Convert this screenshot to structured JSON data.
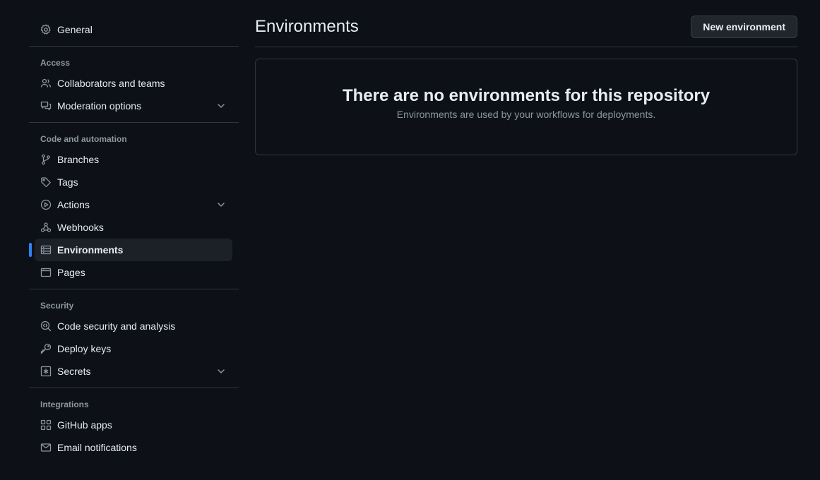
{
  "sidebar": {
    "general": {
      "label": "General",
      "icon": "gear-icon"
    },
    "sections": {
      "access": {
        "heading": "Access",
        "items": [
          {
            "label": "Collaborators and teams",
            "icon": "people-icon"
          },
          {
            "label": "Moderation options",
            "icon": "comment-discussion-icon"
          }
        ]
      },
      "code": {
        "heading": "Code and automation",
        "items": [
          {
            "label": "Branches",
            "icon": "git-branch-icon"
          },
          {
            "label": "Tags",
            "icon": "tag-icon"
          },
          {
            "label": "Actions",
            "icon": "play-icon"
          },
          {
            "label": "Webhooks",
            "icon": "webhook-icon"
          },
          {
            "label": "Environments",
            "icon": "server-icon"
          },
          {
            "label": "Pages",
            "icon": "browser-icon"
          }
        ]
      },
      "security": {
        "heading": "Security",
        "items": [
          {
            "label": "Code security and analysis",
            "icon": "codescan-icon"
          },
          {
            "label": "Deploy keys",
            "icon": "key-icon"
          },
          {
            "label": "Secrets",
            "icon": "key-asterisk-icon"
          }
        ]
      },
      "integrations": {
        "heading": "Integrations",
        "items": [
          {
            "label": "GitHub apps",
            "icon": "apps-icon"
          },
          {
            "label": "Email notifications",
            "icon": "mail-icon"
          }
        ]
      }
    },
    "active_item": "Environments"
  },
  "main": {
    "title": "Environments",
    "new_button_label": "New environment",
    "empty_state": {
      "title": "There are no environments for this repository",
      "description": "Environments are used by your workflows for deployments."
    }
  },
  "colors": {
    "background": "#0d1117",
    "accent": "#2f81f7",
    "border": "#30363d",
    "muted_text": "#8d96a0"
  }
}
